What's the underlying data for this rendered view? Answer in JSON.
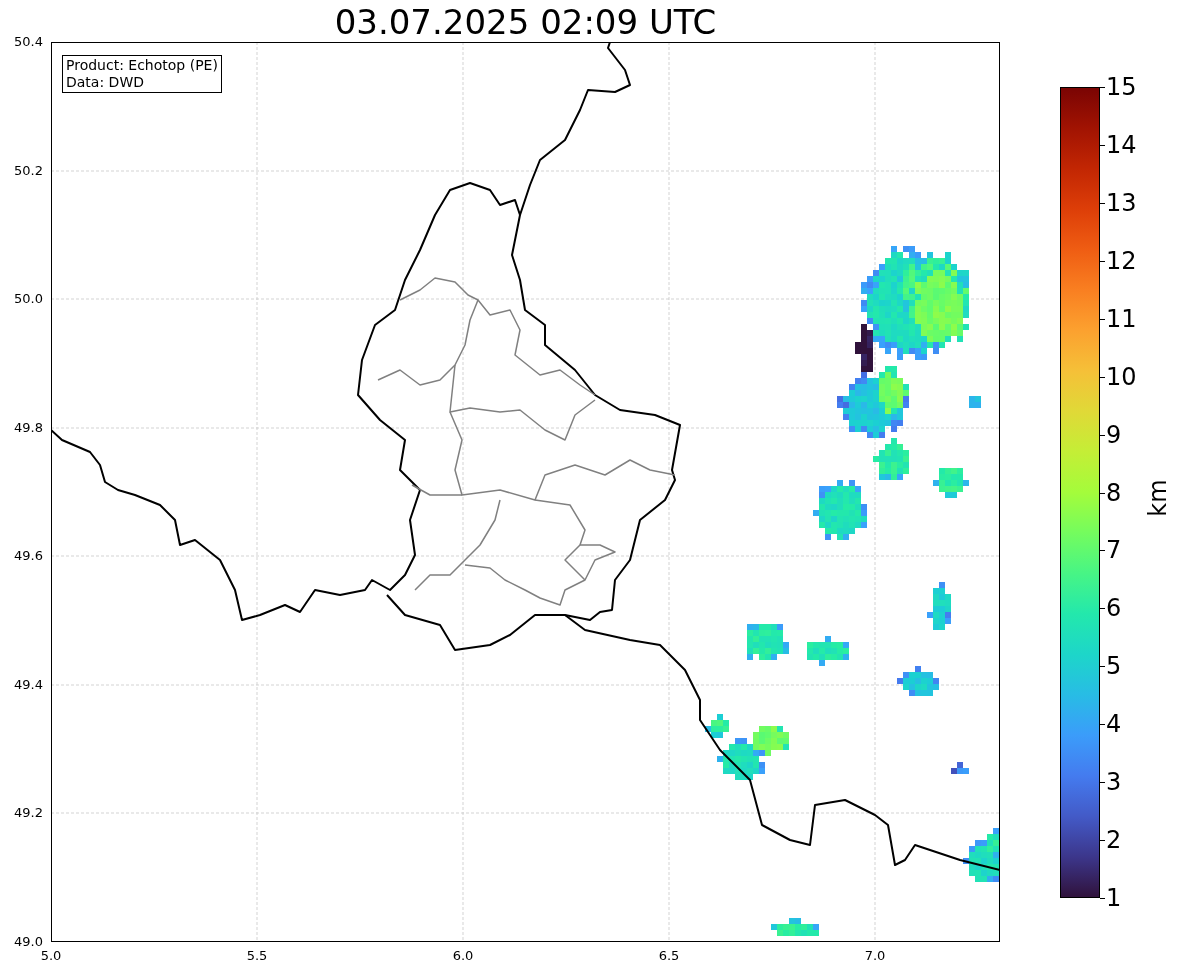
{
  "title": "03.07.2025 02:09 UTC",
  "info_box": {
    "lines": [
      "Product: Echotop (PE)",
      "Data: DWD"
    ]
  },
  "map": {
    "x_ticks": [
      "5.0",
      "5.5",
      "6.0",
      "6.5",
      "7.0"
    ],
    "y_ticks": [
      "50.4",
      "50.2",
      "50.0",
      "49.8",
      "49.6",
      "49.4",
      "49.2",
      "49.0"
    ]
  },
  "colorbar": {
    "label": "km",
    "ticks": [
      "15",
      "14",
      "13",
      "12",
      "11",
      "10",
      "9",
      "8",
      "7",
      "6",
      "5",
      "4",
      "3",
      "2",
      "1"
    ]
  }
}
